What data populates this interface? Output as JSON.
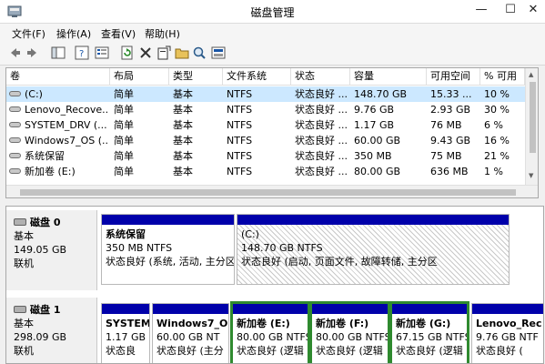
{
  "window": {
    "title": "磁盘管理",
    "minimize": "—",
    "maximize": "☐",
    "close": "✕"
  },
  "menu": [
    "文件(F)",
    "操作(A)",
    "查看(V)",
    "帮助(H)"
  ],
  "toolbar": [
    "back-icon",
    "forward-icon",
    "console-tree-icon",
    "help-icon",
    "properties-icon",
    "refresh-icon",
    "delete-icon",
    "new-icon",
    "open-icon",
    "search-icon",
    "view-icon"
  ],
  "columns": [
    "卷",
    "布局",
    "类型",
    "文件系统",
    "状态",
    "容量",
    "可用空间",
    "% 可用"
  ],
  "volumes": [
    {
      "name": "(C:)",
      "layout": "简单",
      "type": "基本",
      "fs": "NTFS",
      "status": "状态良好 ...",
      "capacity": "148.70 GB",
      "free": "15.33 ...",
      "pct": "10 %"
    },
    {
      "name": "Lenovo_Recove...",
      "layout": "简单",
      "type": "基本",
      "fs": "NTFS",
      "status": "状态良好 ...",
      "capacity": "9.76 GB",
      "free": "2.93 GB",
      "pct": "30 %"
    },
    {
      "name": "SYSTEM_DRV (...",
      "layout": "简单",
      "type": "基本",
      "fs": "NTFS",
      "status": "状态良好 ...",
      "capacity": "1.17 GB",
      "free": "76 MB",
      "pct": "6 %"
    },
    {
      "name": "Windows7_OS (...",
      "layout": "简单",
      "type": "基本",
      "fs": "NTFS",
      "status": "状态良好 ...",
      "capacity": "60.00 GB",
      "free": "9.43 GB",
      "pct": "16 %"
    },
    {
      "name": "系统保留",
      "layout": "简单",
      "type": "基本",
      "fs": "NTFS",
      "status": "状态良好 ...",
      "capacity": "350 MB",
      "free": "75 MB",
      "pct": "21 %"
    },
    {
      "name": "新加卷 (E:)",
      "layout": "简单",
      "type": "基本",
      "fs": "NTFS",
      "status": "状态良好 ...",
      "capacity": "80.00 GB",
      "free": "636 MB",
      "pct": "1 %"
    }
  ],
  "disks": [
    {
      "name": "磁盘 0",
      "type": "基本",
      "size": "149.05 GB",
      "state": "联机",
      "partitions": [
        {
          "title": "系统保留",
          "size": "350 MB NTFS",
          "status": "状态良好 (系统, 活动, 主分区"
        },
        {
          "title": "(C:)",
          "size": "148.70 GB NTFS",
          "status": "状态良好 (启动, 页面文件, 故障转储, 主分区"
        }
      ]
    },
    {
      "name": "磁盘 1",
      "type": "基本",
      "size": "298.09 GB",
      "state": "联机",
      "partitions": [
        {
          "title": "SYSTEM",
          "size": "1.17 GB",
          "status": "状态良"
        },
        {
          "title": "Windows7_OS",
          "size": "60.00 GB NT",
          "status": "状态良好 (主分"
        },
        {
          "title": "新加卷 (E:)",
          "size": "80.00 GB NTFS",
          "status": "状态良好 (逻辑"
        },
        {
          "title": "新加卷 (F:)",
          "size": "80.00 GB NTFS",
          "status": "状态良好 (逻辑"
        },
        {
          "title": "新加卷 (G:)",
          "size": "67.15 GB NTFS",
          "status": "状态良好 (逻辑"
        },
        {
          "title": "Lenovo_Rec",
          "size": "9.76 GB NTF",
          "status": "状态良好 ("
        }
      ]
    }
  ],
  "colors": {
    "primary_partition": "#0000aa",
    "selected_border": "#2f8a2f",
    "selected_row": "#cce8ff"
  }
}
